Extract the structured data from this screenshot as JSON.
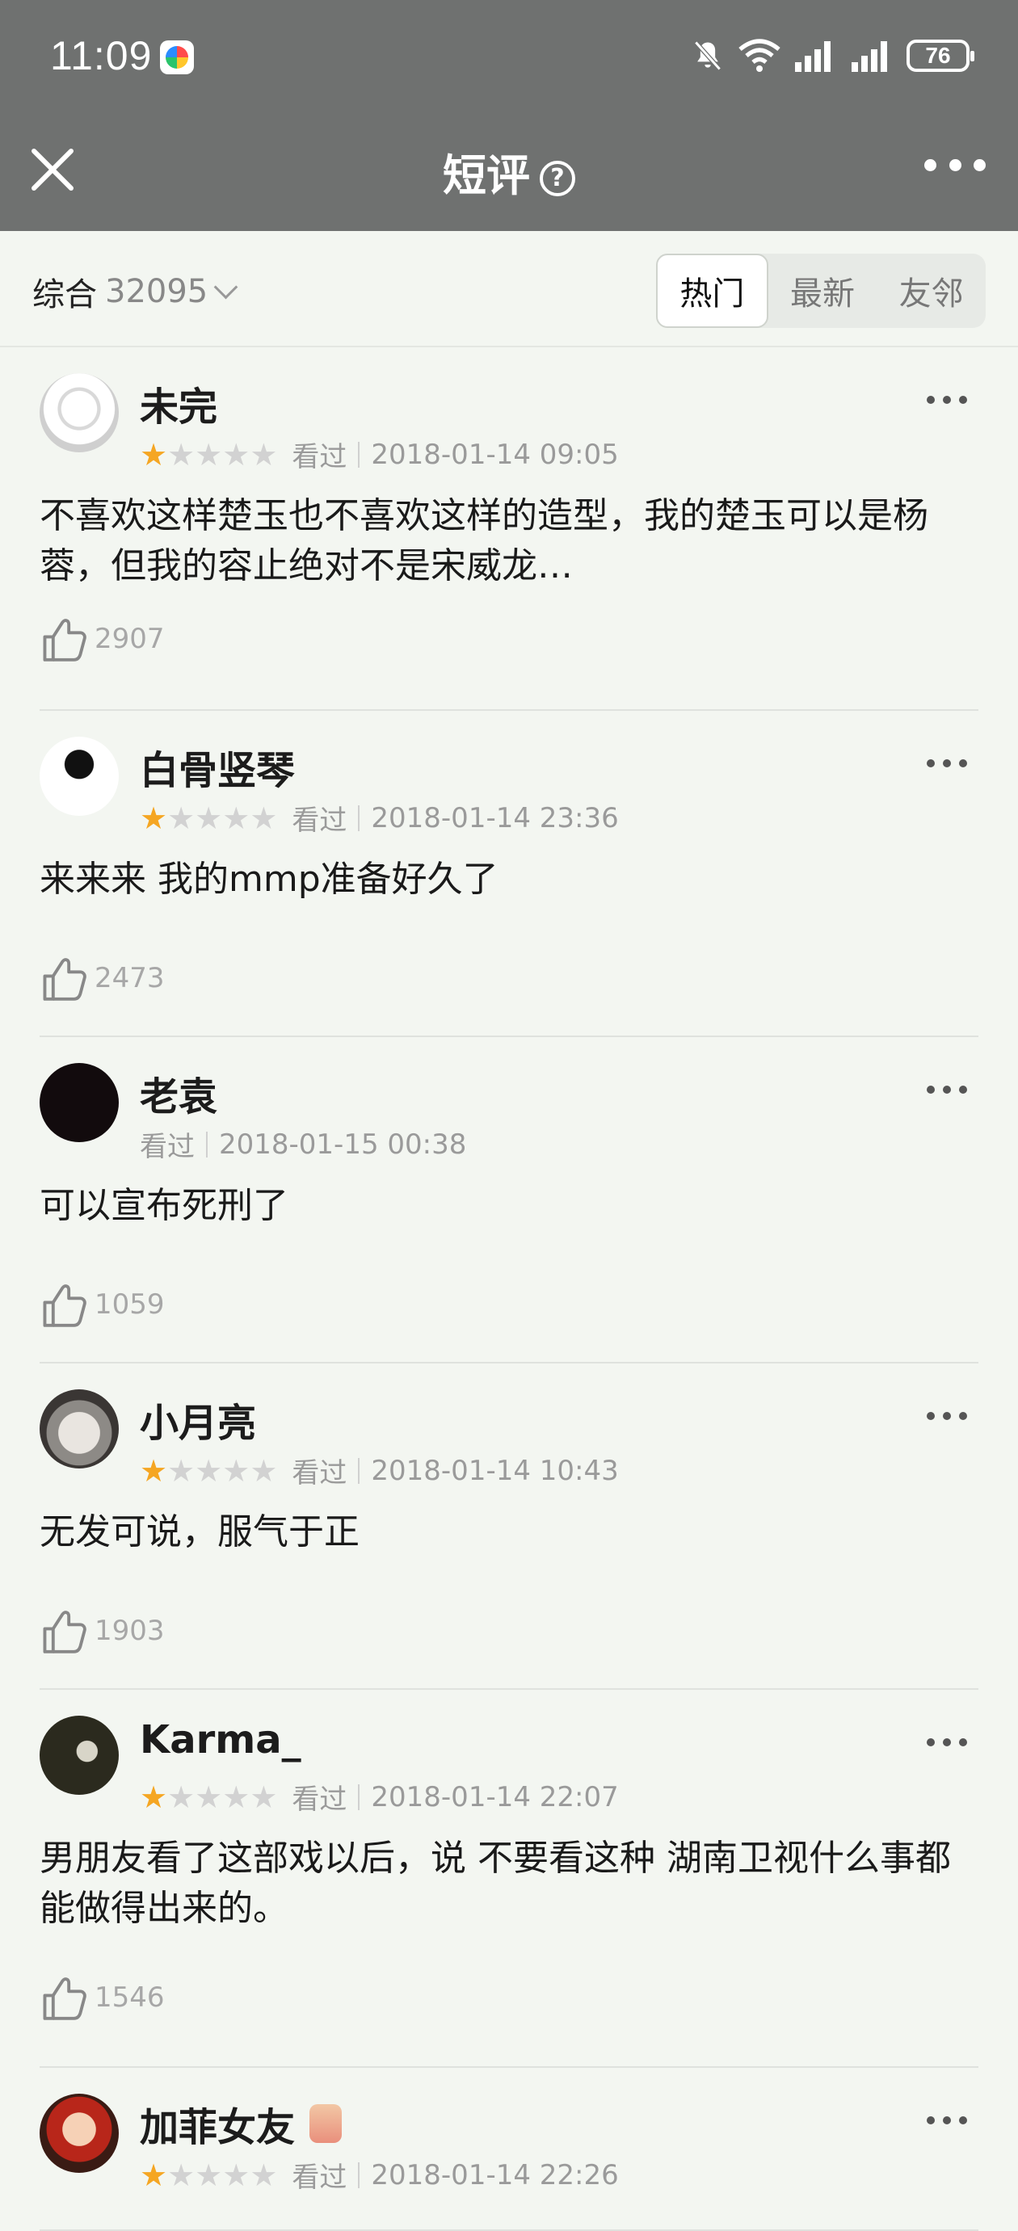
{
  "status": {
    "time": "11:09",
    "battery": "76"
  },
  "header": {
    "title": "短评",
    "help": "?"
  },
  "filter": {
    "sort_label": "综合",
    "count": "32095",
    "tabs": [
      "热门",
      "最新",
      "友邻"
    ],
    "active_tab": 0
  },
  "colors": {
    "header_bg": "#6f7170",
    "star_on": "#f5a623",
    "page_bg": "#f3f6f1"
  },
  "comments": [
    {
      "user": "未完",
      "rating": 1,
      "status": "看过",
      "time": "2018-01-14 09:05",
      "text": "不喜欢这样楚玉也不喜欢这样的造型，我的楚玉可以是杨蓉，但我的容止绝对不是宋威龙…",
      "likes": "2907"
    },
    {
      "user": "白骨竖琴",
      "rating": 1,
      "status": "看过",
      "time": "2018-01-14 23:36",
      "text": "来来来 我的mmp准备好久了",
      "likes": "2473"
    },
    {
      "user": "老袁",
      "rating": 0,
      "status": "看过",
      "time": "2018-01-15 00:38",
      "text": "可以宣布死刑了",
      "likes": "1059"
    },
    {
      "user": "小月亮",
      "rating": 1,
      "status": "看过",
      "time": "2018-01-14 10:43",
      "text": "无发可说，服气于正",
      "likes": "1903"
    },
    {
      "user": "Karma_",
      "rating": 1,
      "status": "看过",
      "time": "2018-01-14 22:07",
      "text": "男朋友看了这部戏以后，说 不要看这种 湖南卫视什么事都能做得出来的。",
      "likes": "1546"
    },
    {
      "user": "加菲女友",
      "rating": 1,
      "status": "看过",
      "time": "2018-01-14 22:26",
      "text": "",
      "likes": ""
    }
  ]
}
